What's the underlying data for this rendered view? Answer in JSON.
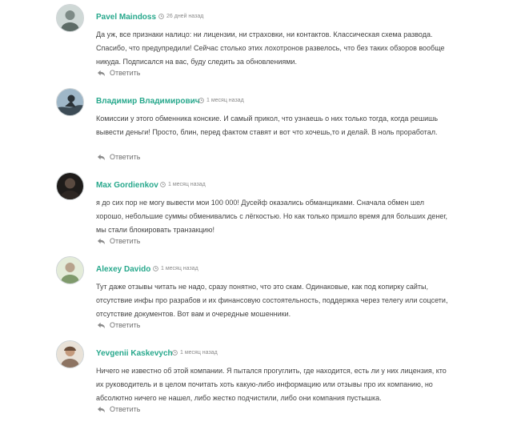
{
  "reply_label": "Ответить",
  "comments": [
    {
      "author": "Pavel Maindoss",
      "time": "26 дней назад",
      "avatar": "avatar-photo",
      "text": "Да уж, все признаки налицо: ни лицензии, ни страховки, ни контактов. Классическая схема развода. Спасибо, что предупредили! Сейчас столько этих лохотронов развелось, что без таких обзоров вообще никуда. Подписался на вас, буду следить за обновлениями."
    },
    {
      "author": "Владимир Владимирович",
      "time": "1 месяц назад",
      "avatar": "avatar-photo",
      "text": "Комиссии у этого обменника конские. И самый прикол, что узнаешь о них только тогда, когда решишь вывести деньги! Просто, блин, перед фактом ставят и вот что хочешь,то и делай. В ноль проработал."
    },
    {
      "author": "Max Gordienkov",
      "time": "1 месяц назад",
      "avatar": "avatar-photo",
      "text": "я до сих пор не могу вывести мои 100 000! Дусейф оказались обманщиками. Сначала обмен шел хорошо, небольшие суммы обменивались с лёгкостью. Но как только пришло время для больших денег, мы стали блокировать транзакцию!"
    },
    {
      "author": "Alexey Davido",
      "time": "1 месяц назад",
      "avatar": "avatar-photo",
      "text": "Тут даже отзывы читать не надо, сразу понятно, что это скам. Одинаковые, как под копирку сайты, отсутствие инфы про разрабов и их финансовую состоятельность, поддержка через телегу или соцсети, отсутствие документов. Вот вам и очередные мошенники."
    },
    {
      "author": "Yevgenii Kaskevych",
      "time": "1 месяц назад",
      "avatar": "avatar-photo",
      "text": "Ничего не известно об этой компании. Я пытался прогуглить, где находится, есть ли у них лицензия, кто их руководитель и в целом почитать хоть какую-либо информацию или отзывы про их компанию, но абсолютно ничего не нашел, либо жестко подчистили, либо они компания пустышка."
    }
  ]
}
